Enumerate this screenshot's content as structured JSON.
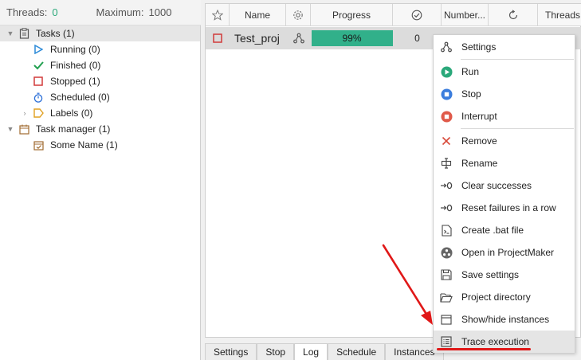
{
  "threads": {
    "label": "Threads:",
    "value": "0",
    "max_label": "Maximum:",
    "max_value": "1000"
  },
  "tree": {
    "tasks": "Tasks (1)",
    "running": "Running (0)",
    "finished": "Finished (0)",
    "stopped": "Stopped (1)",
    "scheduled": "Scheduled (0)",
    "labels": "Labels (0)",
    "task_manager": "Task manager (1)",
    "some_name": "Some Name (1)"
  },
  "table": {
    "headers": {
      "name": "Name",
      "progress": "Progress",
      "number": "Number...",
      "threads": "Threads"
    },
    "row": {
      "name": "Test_proj",
      "progress": "99%",
      "progress_value": 0.99,
      "success": "0"
    }
  },
  "tabs": [
    "Settings",
    "Stop",
    "Log",
    "Schedule",
    "Instances"
  ],
  "menu": {
    "settings": "Settings",
    "run": "Run",
    "stop": "Stop",
    "interrupt": "Interrupt",
    "remove": "Remove",
    "rename": "Rename",
    "clear_successes": "Clear successes",
    "reset_failures": "Reset failures in a row",
    "create_bat": "Create .bat file",
    "open_projectmaker": "Open in ProjectMaker",
    "save_settings": "Save settings",
    "project_directory": "Project directory",
    "show_hide_instances": "Show/hide instances",
    "trace_execution": "Trace execution"
  },
  "colors": {
    "accent_green": "#31b08a",
    "run_green": "#2aa87a",
    "stop_blue": "#3b7ddd",
    "interrupt_red": "#e05a4a",
    "annotation_red": "#e01818"
  }
}
